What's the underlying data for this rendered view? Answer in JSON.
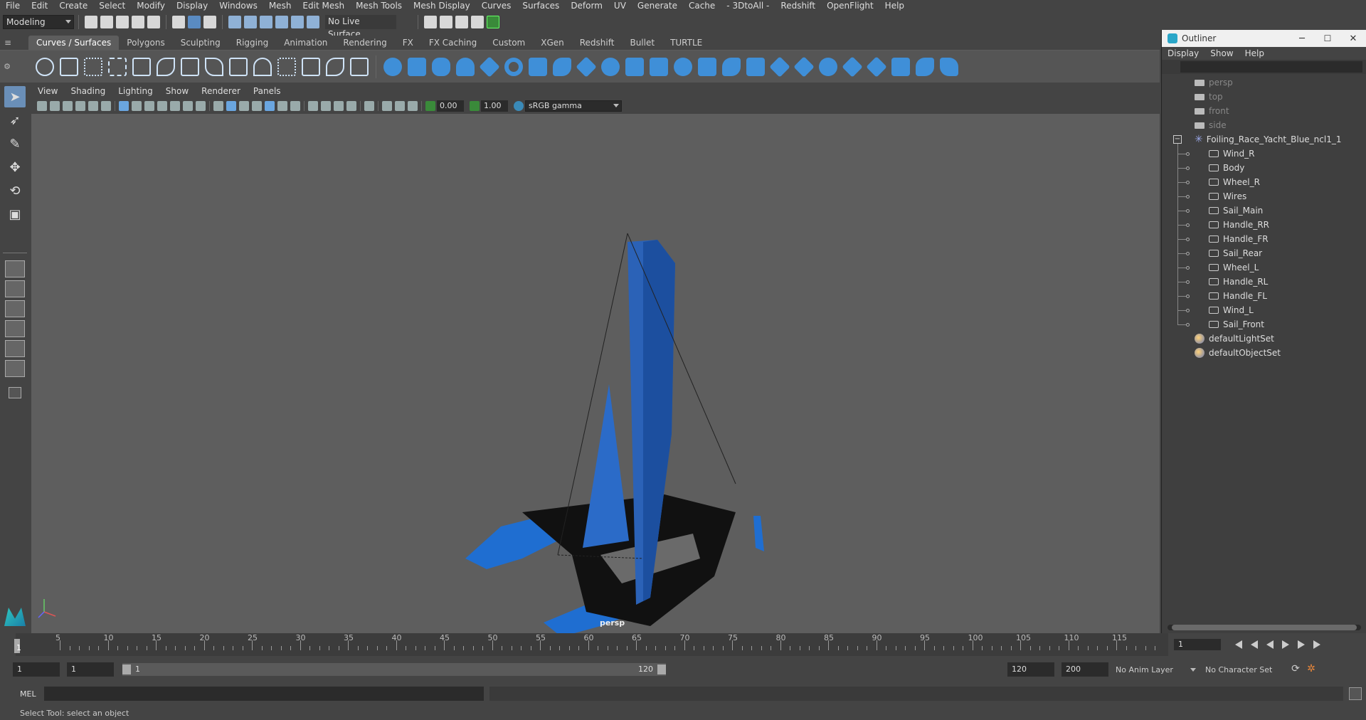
{
  "menubar": [
    "File",
    "Edit",
    "Create",
    "Select",
    "Modify",
    "Display",
    "Windows",
    "Mesh",
    "Edit Mesh",
    "Mesh Tools",
    "Mesh Display",
    "Curves",
    "Surfaces",
    "Deform",
    "UV",
    "Generate",
    "Cache",
    "- 3DtoAll -",
    "Redshift",
    "OpenFlight",
    "Help"
  ],
  "statusline": {
    "workspace": "Modeling",
    "live_surface": "No Live Surface"
  },
  "shelf_tabs": [
    "Curves / Surfaces",
    "Polygons",
    "Sculpting",
    "Rigging",
    "Animation",
    "Rendering",
    "FX",
    "FX Caching",
    "Custom",
    "XGen",
    "Redshift",
    "Bullet",
    "TURTLE"
  ],
  "viewport": {
    "menu": [
      "View",
      "Shading",
      "Lighting",
      "Show",
      "Renderer",
      "Panels"
    ],
    "exposure": "0.00",
    "gamma": "1.00",
    "color_space": "sRGB gamma",
    "camera_label": "persp"
  },
  "outliner": {
    "title": "Outliner",
    "menu": [
      "Display",
      "Show",
      "Help"
    ],
    "cameras": [
      "persp",
      "top",
      "front",
      "side"
    ],
    "group": "Foiling_Race_Yacht_Blue_ncl1_1",
    "children": [
      "Wind_R",
      "Body",
      "Wheel_R",
      "Wires",
      "Sail_Main",
      "Handle_RR",
      "Handle_FR",
      "Sail_Rear",
      "Wheel_L",
      "Handle_RL",
      "Handle_FL",
      "Wind_L",
      "Sail_Front"
    ],
    "sets": [
      "defaultLightSet",
      "defaultObjectSet"
    ]
  },
  "timeline": {
    "ticks": [
      "5",
      "10",
      "15",
      "20",
      "25",
      "30",
      "35",
      "40",
      "45",
      "50",
      "55",
      "60",
      "65",
      "70",
      "75",
      "80",
      "85",
      "90",
      "95",
      "100",
      "105",
      "110",
      "115"
    ],
    "start_label": "1",
    "current_frame": "1"
  },
  "range": {
    "start": "1",
    "playback_start": "1",
    "range_start_label": "1",
    "range_end_label": "120",
    "playback_end": "120",
    "end": "200",
    "anim_layer": "No Anim Layer",
    "character_set": "No Character Set"
  },
  "cmdline": {
    "label": "MEL"
  },
  "helpline": "Select Tool: select an object"
}
